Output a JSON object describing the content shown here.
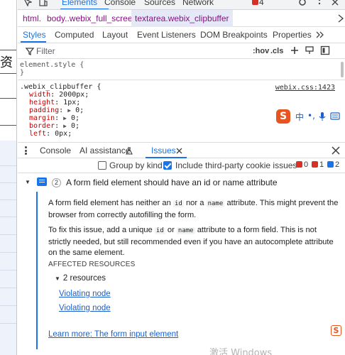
{
  "page_strip": {
    "char": "资"
  },
  "topbar": {
    "items": [
      "Elements",
      "Console",
      "Sources",
      "Network"
    ],
    "error_count": "4"
  },
  "breadcrumb": [
    "html.",
    "body..webix_full_screen",
    "textarea.webix_clipbuffer"
  ],
  "styles_tabs": [
    "Styles",
    "Computed",
    "Layout",
    "Event Listeners",
    "DOM Breakpoints",
    "Properties"
  ],
  "filter": {
    "placeholder": "Filter",
    "hov": ":hov",
    "cls": ".cls"
  },
  "rules": {
    "element_style": "element.style {",
    "element_style_close": "}",
    "selector": ".webix_clipbuffer {",
    "source": "webix.css:1423",
    "declarations": [
      {
        "prop": "width",
        "val": "2000px;"
      },
      {
        "prop": "height",
        "val": "1px;"
      },
      {
        "prop": "padding",
        "val": "0;",
        "expandable": true
      },
      {
        "prop": "margin",
        "val": "0;",
        "expandable": true
      },
      {
        "prop": "border",
        "val": "0;",
        "expandable": true
      },
      {
        "prop": "left",
        "val": "0px;"
      }
    ]
  },
  "ime": {
    "logo": "S",
    "lang": "中",
    "punct": "•,",
    "mic": "mic",
    "keyboard": "keyboard"
  },
  "drawer": {
    "tabs": [
      "Console",
      "AI assistance",
      "Issues"
    ],
    "group_by_kind": "Group by kind",
    "include_third_party": "Include third-party cookie issues",
    "counts": {
      "errors": "0",
      "warnings": "1",
      "info": "2"
    }
  },
  "issue": {
    "count": "2",
    "title": "A form field element should have an id or name attribute",
    "p1_a": "A form field element has neither an ",
    "p1_code1": "id",
    "p1_b": " nor a ",
    "p1_code2": "name",
    "p1_c": " attribute. This might prevent the browser from correctly autofilling the form.",
    "p2_a": "To fix this issue, add a unique ",
    "p2_code1": "id",
    "p2_b": " or ",
    "p2_code2": "name",
    "p2_c": " attribute to a form field. This is not strictly needed, but still recommended even if you have an autocomplete attribute on the same element.",
    "affected": "AFFECTED RESOURCES",
    "resources": "2 resources",
    "links": [
      "Violating node",
      "Violating node"
    ],
    "learn_more": "Learn more: The form input element"
  },
  "watermark": "激活 Windows",
  "colors": {
    "accent": "#1a73e8",
    "error": "#d93025",
    "warning": "#e37400",
    "info": "#1a73e8",
    "sogou": "#e8541d"
  }
}
